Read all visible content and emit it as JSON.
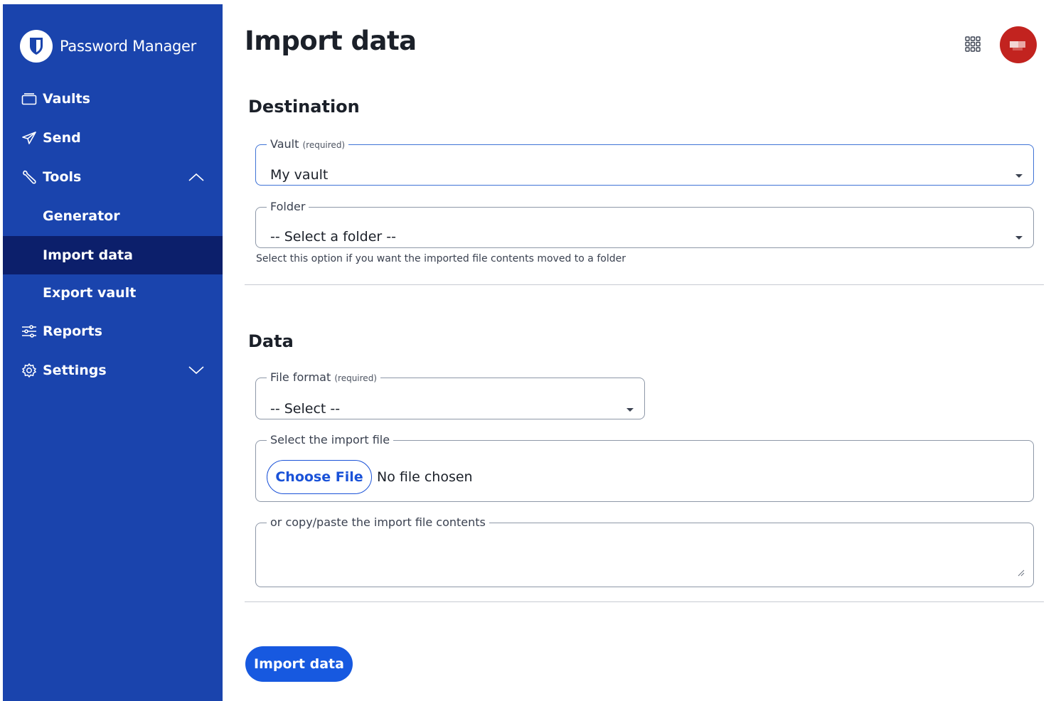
{
  "sidebar": {
    "brand": "Password Manager",
    "items": [
      {
        "label": "Vaults",
        "icon": "vault-icon"
      },
      {
        "label": "Send",
        "icon": "paper-plane-icon"
      },
      {
        "label": "Tools",
        "icon": "wrench-icon",
        "expanded": true
      },
      {
        "label": "Generator",
        "sub": true
      },
      {
        "label": "Import data",
        "sub": true,
        "active": true
      },
      {
        "label": "Export vault",
        "sub": true
      },
      {
        "label": "Reports",
        "icon": "sliders-icon"
      },
      {
        "label": "Settings",
        "icon": "gear-icon",
        "expanded": false
      }
    ]
  },
  "header": {
    "title": "Import data",
    "apps_icon": "grid-icon",
    "avatar_color": "#c2231f"
  },
  "destination": {
    "title": "Destination",
    "vault": {
      "label": "Vault",
      "required": "(required)",
      "value": "My vault"
    },
    "folder": {
      "label": "Folder",
      "value": "-- Select a folder --",
      "hint": "Select this option if you want the imported file contents moved to a folder"
    }
  },
  "data": {
    "title": "Data",
    "file_format": {
      "label": "File format",
      "required": "(required)",
      "value": "-- Select --"
    },
    "import_file": {
      "label": "Select the import file",
      "button": "Choose File",
      "status": "No file chosen"
    },
    "paste": {
      "label": "or copy/paste the import file contents",
      "value": ""
    }
  },
  "actions": {
    "import_label": "Import data"
  },
  "colors": {
    "sidebar": "#1a44ad",
    "sidebar_active": "#0c1f6b",
    "primary": "#1759e0",
    "focus_border": "#3f73d6"
  }
}
